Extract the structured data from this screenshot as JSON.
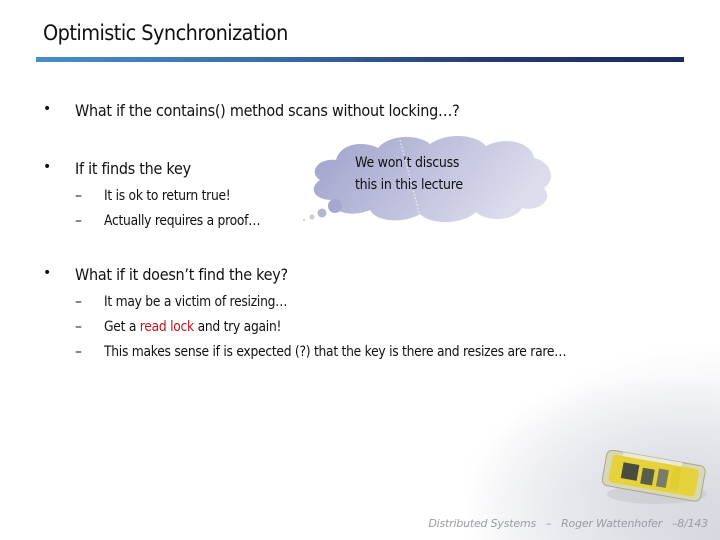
{
  "slide": {
    "title": "Optimistic Synchronization",
    "accent_gradient": [
      "#4a8cc7",
      "#1c2a5e"
    ],
    "bullets": [
      {
        "marker": "•",
        "text": "What if the contains() method scans without locking…?"
      },
      {
        "marker": "•",
        "text": "If it finds the key",
        "subs": [
          {
            "marker": "–",
            "text": "It is ok to return true!"
          },
          {
            "marker": "–",
            "text": "Actually requires a proof…"
          }
        ]
      },
      {
        "marker": "•",
        "text": "What if it doesn’t find the key?",
        "subs": [
          {
            "marker": "–",
            "text": "It may be a victim of resizing…"
          },
          {
            "marker": "–",
            "parts": {
              "before": "Get a ",
              "highlight": "read lock",
              "after": " and try again!"
            },
            "highlight_color": "#c0141c"
          },
          {
            "marker": "–",
            "text": "This makes sense if is expected (?) that the key is there and resizes are rare…"
          }
        ]
      }
    ],
    "thought_bubble": {
      "line1": "We won’t discuss",
      "line2": "this in this lecture",
      "colors": [
        "#9ea1cb",
        "#dcdced"
      ]
    },
    "footer": {
      "course": "Distributed Systems",
      "separator": "–",
      "author": "Roger Wattenhofer",
      "page": "–8/143"
    }
  }
}
